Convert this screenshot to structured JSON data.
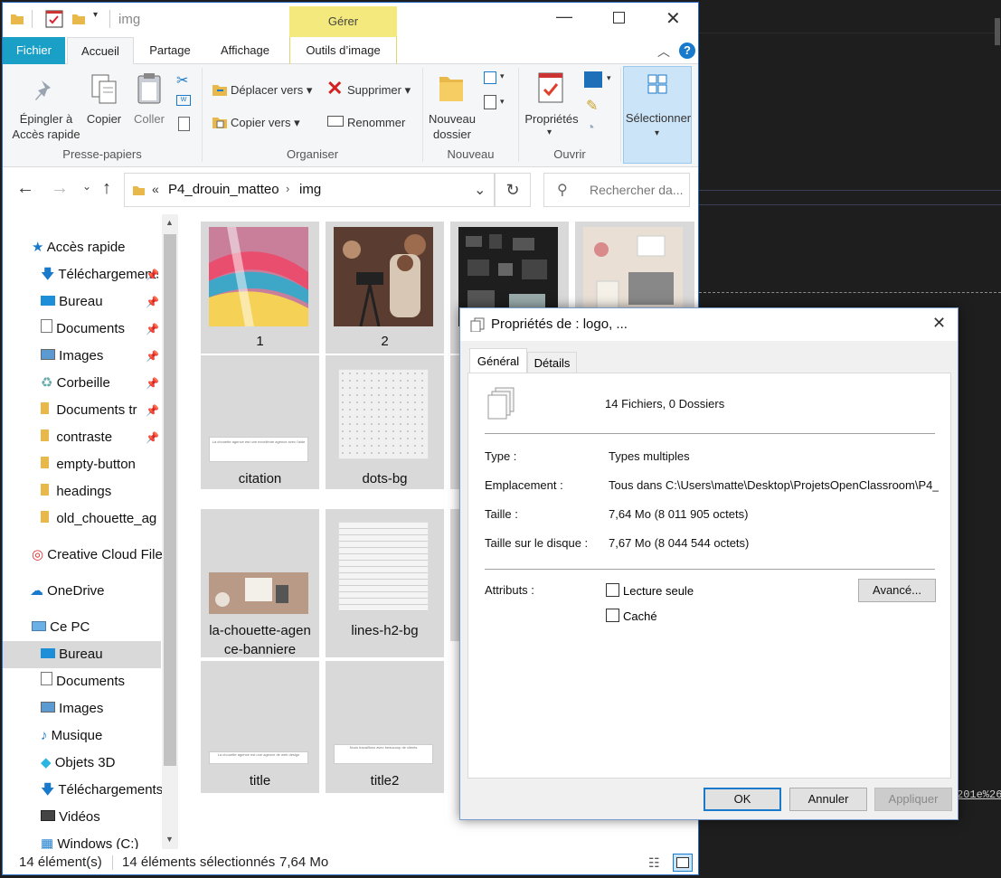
{
  "background": {
    "code_snippet": "201e%26"
  },
  "explorer": {
    "title": "img",
    "contextual_tab": "Gérer",
    "tabs": [
      "Fichier",
      "Accueil",
      "Partage",
      "Affichage",
      "Outils d’image"
    ],
    "ribbon": {
      "pin_line1": "Épingler à",
      "pin_line2": "Accès rapide",
      "copy": "Copier",
      "paste": "Coller",
      "group_clipboard": "Presse-papiers",
      "move_to": "Déplacer vers",
      "copy_to": "Copier vers",
      "delete": "Supprimer",
      "rename": "Renommer",
      "group_organize": "Organiser",
      "new_folder_line1": "Nouveau",
      "new_folder_line2": "dossier",
      "group_new": "Nouveau",
      "properties": "Propriétés",
      "group_open": "Ouvrir",
      "select": "Sélectionner"
    },
    "address": {
      "overflow": "«",
      "parent": "P4_drouin_matteo",
      "current": "img"
    },
    "search_placeholder": "Rechercher da...",
    "nav": {
      "quick_access": "Accès rapide",
      "quick_items": [
        "Téléchargements",
        "Bureau",
        "Documents",
        "Images",
        "Corbeille",
        "Documents tr",
        "contraste",
        "empty-button",
        "headings",
        "old_chouette_ag"
      ],
      "creative_cloud": "Creative Cloud Files",
      "onedrive": "OneDrive",
      "this_pc": "Ce PC",
      "pc_items": [
        "Bureau",
        "Documents",
        "Images",
        "Musique",
        "Objets 3D",
        "Téléchargements",
        "Vidéos",
        "Windows (C:)"
      ]
    },
    "files": [
      "1",
      "2",
      "citation",
      "dots-bg",
      "la-chouette-agen ce-banniere",
      "lines-h2-bg",
      "title",
      "title2"
    ],
    "status": {
      "count": "14 élément(s)",
      "selected": "14 éléments sélectionnés",
      "size": "7,64 Mo"
    }
  },
  "dialog": {
    "title": "Propriétés de : logo, ...",
    "tabs": [
      "Général",
      "Détails"
    ],
    "summary": "14 Fichiers, 0 Dossiers",
    "type_label": "Type :",
    "type_value": "Types multiples",
    "location_label": "Emplacement :",
    "location_value": "Tous dans C:\\Users\\matte\\Desktop\\ProjetsOpenClassroom\\P4_",
    "size_label": "Taille :",
    "size_value": "7,64 Mo (8 011 905 octets)",
    "disk_size_label": "Taille sur le disque :",
    "disk_size_value": "7,67 Mo (8 044 544 octets)",
    "attributes_label": "Attributs :",
    "readonly_label": "Lecture seule",
    "hidden_label": "Caché",
    "advanced_button": "Avancé...",
    "ok_button": "OK",
    "cancel_button": "Annuler",
    "apply_button": "Appliquer"
  },
  "colors": {
    "accent": "#1979ca",
    "file_tab": "#1a9fc6",
    "contextual": "#f4e97c"
  }
}
